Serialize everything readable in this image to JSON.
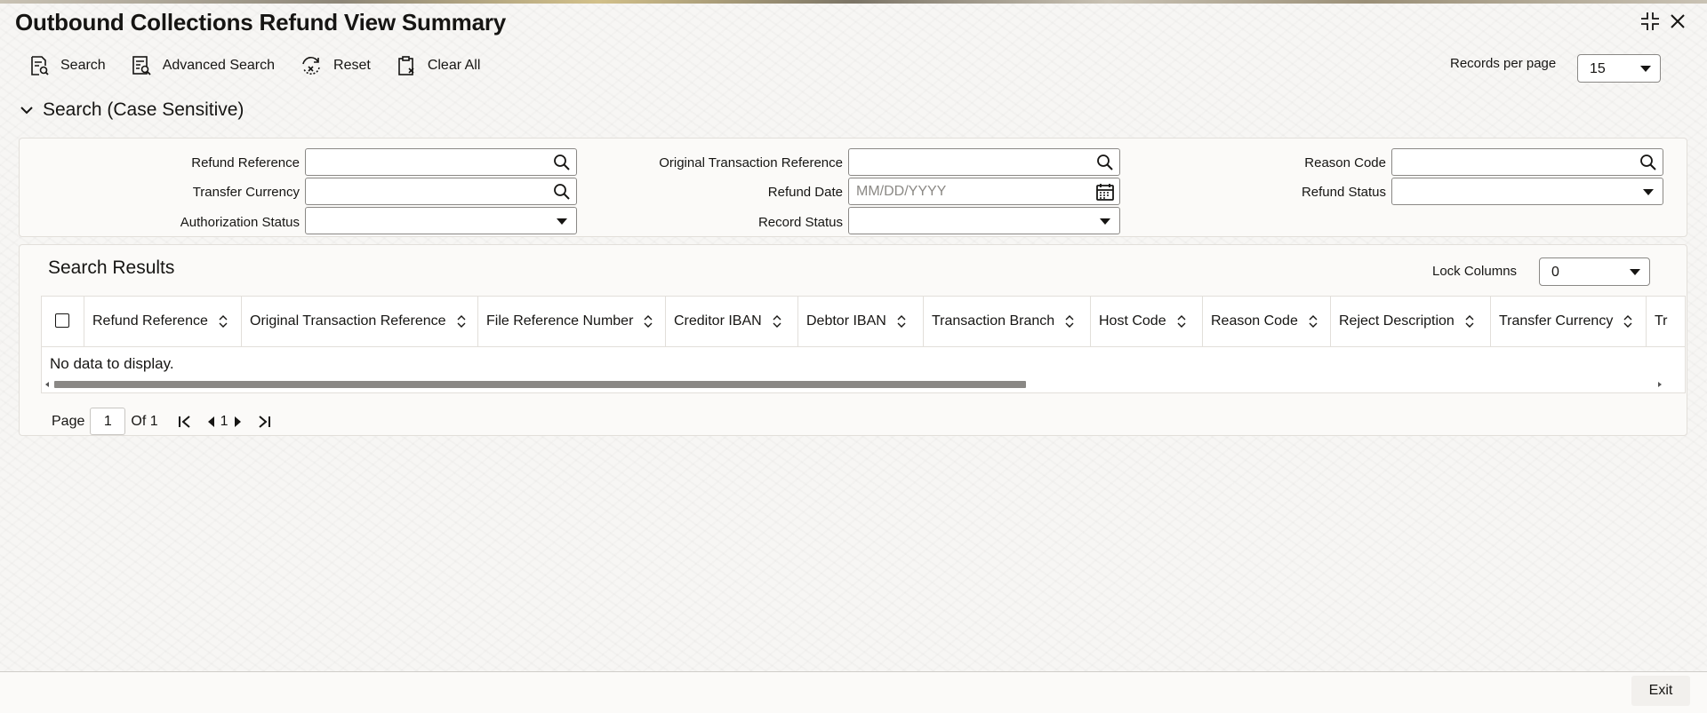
{
  "window": {
    "title": "Outbound Collections Refund View Summary"
  },
  "toolbar": {
    "search_label": "Search",
    "advanced_search_label": "Advanced Search",
    "reset_label": "Reset",
    "clear_all_label": "Clear All"
  },
  "records_per_page": {
    "label": "Records per page",
    "value": "15"
  },
  "search_section": {
    "title": "Search (Case Sensitive)",
    "fields": {
      "refund_reference": {
        "label": "Refund Reference",
        "value": ""
      },
      "original_transaction_reference": {
        "label": "Original Transaction Reference",
        "value": ""
      },
      "reason_code": {
        "label": "Reason Code",
        "value": ""
      },
      "transfer_currency": {
        "label": "Transfer Currency",
        "value": ""
      },
      "refund_date": {
        "label": "Refund Date",
        "value": "",
        "placeholder": "MM/DD/YYYY"
      },
      "refund_status": {
        "label": "Refund Status",
        "value": ""
      },
      "authorization_status": {
        "label": "Authorization Status",
        "value": ""
      },
      "record_status": {
        "label": "Record Status",
        "value": ""
      }
    }
  },
  "results": {
    "title": "Search Results",
    "lock_columns": {
      "label": "Lock Columns",
      "value": "0"
    },
    "columns": [
      "Refund Reference",
      "Original Transaction Reference",
      "File Reference Number",
      "Creditor IBAN",
      "Debtor IBAN",
      "Transaction Branch",
      "Host Code",
      "Reason Code",
      "Reject Description",
      "Transfer Currency",
      "Tr"
    ],
    "empty_message": "No data to display."
  },
  "pagination": {
    "page_label": "Page",
    "current_page": "1",
    "of_label": "Of 1",
    "page_number": "1"
  },
  "footer": {
    "exit_label": "Exit"
  }
}
